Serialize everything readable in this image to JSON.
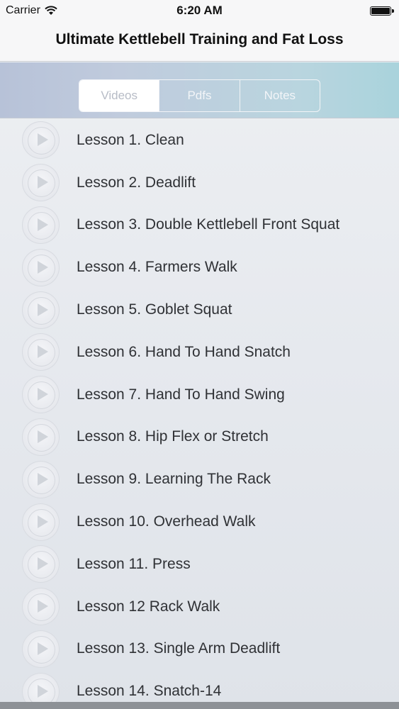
{
  "status_bar": {
    "carrier": "Carrier",
    "time": "6:20 AM",
    "wifi_icon": "wifi-icon",
    "battery_icon": "battery-icon"
  },
  "navbar": {
    "title": "Ultimate Kettlebell Training and Fat Loss"
  },
  "tabs": [
    {
      "label": "Videos",
      "selected": true
    },
    {
      "label": "Pdfs",
      "selected": false
    },
    {
      "label": "Notes",
      "selected": false
    }
  ],
  "lessons": [
    {
      "label": "Lesson 1. Clean",
      "icon": "play-icon"
    },
    {
      "label": "Lesson 2. Deadlift",
      "icon": "play-icon"
    },
    {
      "label": "Lesson 3. Double Kettlebell Front Squat",
      "icon": "play-icon"
    },
    {
      "label": "Lesson 4. Farmers Walk",
      "icon": "play-icon"
    },
    {
      "label": "Lesson 5. Goblet Squat",
      "icon": "play-icon"
    },
    {
      "label": "Lesson 6. Hand To Hand Snatch",
      "icon": "play-icon"
    },
    {
      "label": "Lesson 7. Hand To Hand Swing",
      "icon": "play-icon"
    },
    {
      "label": "Lesson 8. Hip Flex or Stretch",
      "icon": "play-icon"
    },
    {
      "label": "Lesson 9. Learning The Rack",
      "icon": "play-icon"
    },
    {
      "label": "Lesson 10. Overhead Walk",
      "icon": "play-icon"
    },
    {
      "label": "Lesson 11. Press",
      "icon": "play-icon"
    },
    {
      "label": "Lesson 12 Rack Walk",
      "icon": "play-icon"
    },
    {
      "label": "Lesson 13. Single Arm Deadlift",
      "icon": "play-icon"
    },
    {
      "label": "Lesson 14. Snatch-14",
      "icon": "play-icon"
    }
  ],
  "colors": {
    "segment_gradient_start": "#b7c2d8",
    "segment_gradient_end": "#a9d3dc",
    "selected_tab_bg": "#ffffff"
  }
}
